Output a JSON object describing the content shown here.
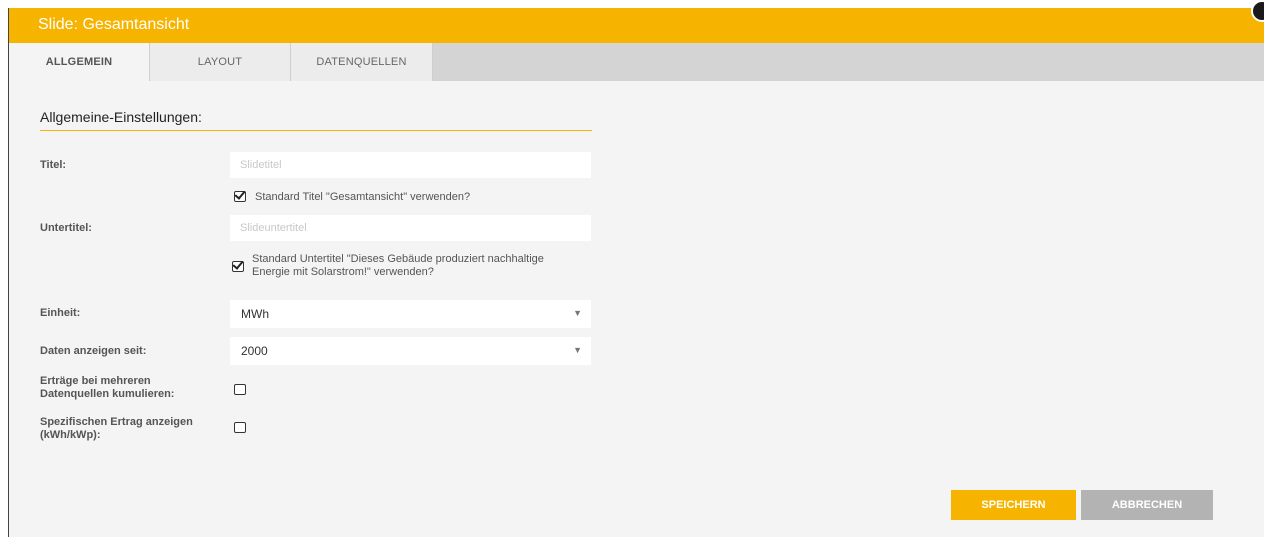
{
  "dialog": {
    "title": "Slide: Gesamtansicht"
  },
  "tabs": [
    {
      "label": "ALLGEMEIN",
      "active": true
    },
    {
      "label": "LAYOUT",
      "active": false
    },
    {
      "label": "DATENQUELLEN",
      "active": false
    }
  ],
  "section": {
    "title": "Allgemeine-Einstellungen:"
  },
  "form": {
    "title_label": "Titel:",
    "title_value": "",
    "title_placeholder": "Slidetitel",
    "title_default_checked": true,
    "title_default_label": "Standard Titel \"Gesamtansicht\" verwenden?",
    "subtitle_label": "Untertitel:",
    "subtitle_value": "",
    "subtitle_placeholder": "Slideuntertitel",
    "subtitle_default_checked": true,
    "subtitle_default_label_line1": "Standard Untertitel \"Dieses Gebäude produziert nachhaltige",
    "subtitle_default_label_line2": "Energie mit Solarstrom!\" verwenden?",
    "unit_label": "Einheit:",
    "unit_value": "MWh",
    "since_label": "Daten anzeigen seit:",
    "since_value": "2000",
    "cumulate_label_line1": "Erträge bei mehreren",
    "cumulate_label_line2": "Datenquellen kumulieren:",
    "cumulate_checked": false,
    "specific_label_line1": "Spezifischen Ertrag anzeigen",
    "specific_label_line2": "(kWh/kWp):",
    "specific_checked": false
  },
  "buttons": {
    "save": "SPEICHERN",
    "cancel": "ABBRECHEN"
  },
  "colors": {
    "accent": "#f6b400",
    "secondary_button": "#b3b3b3",
    "tabbar": "#d4d4d4"
  }
}
